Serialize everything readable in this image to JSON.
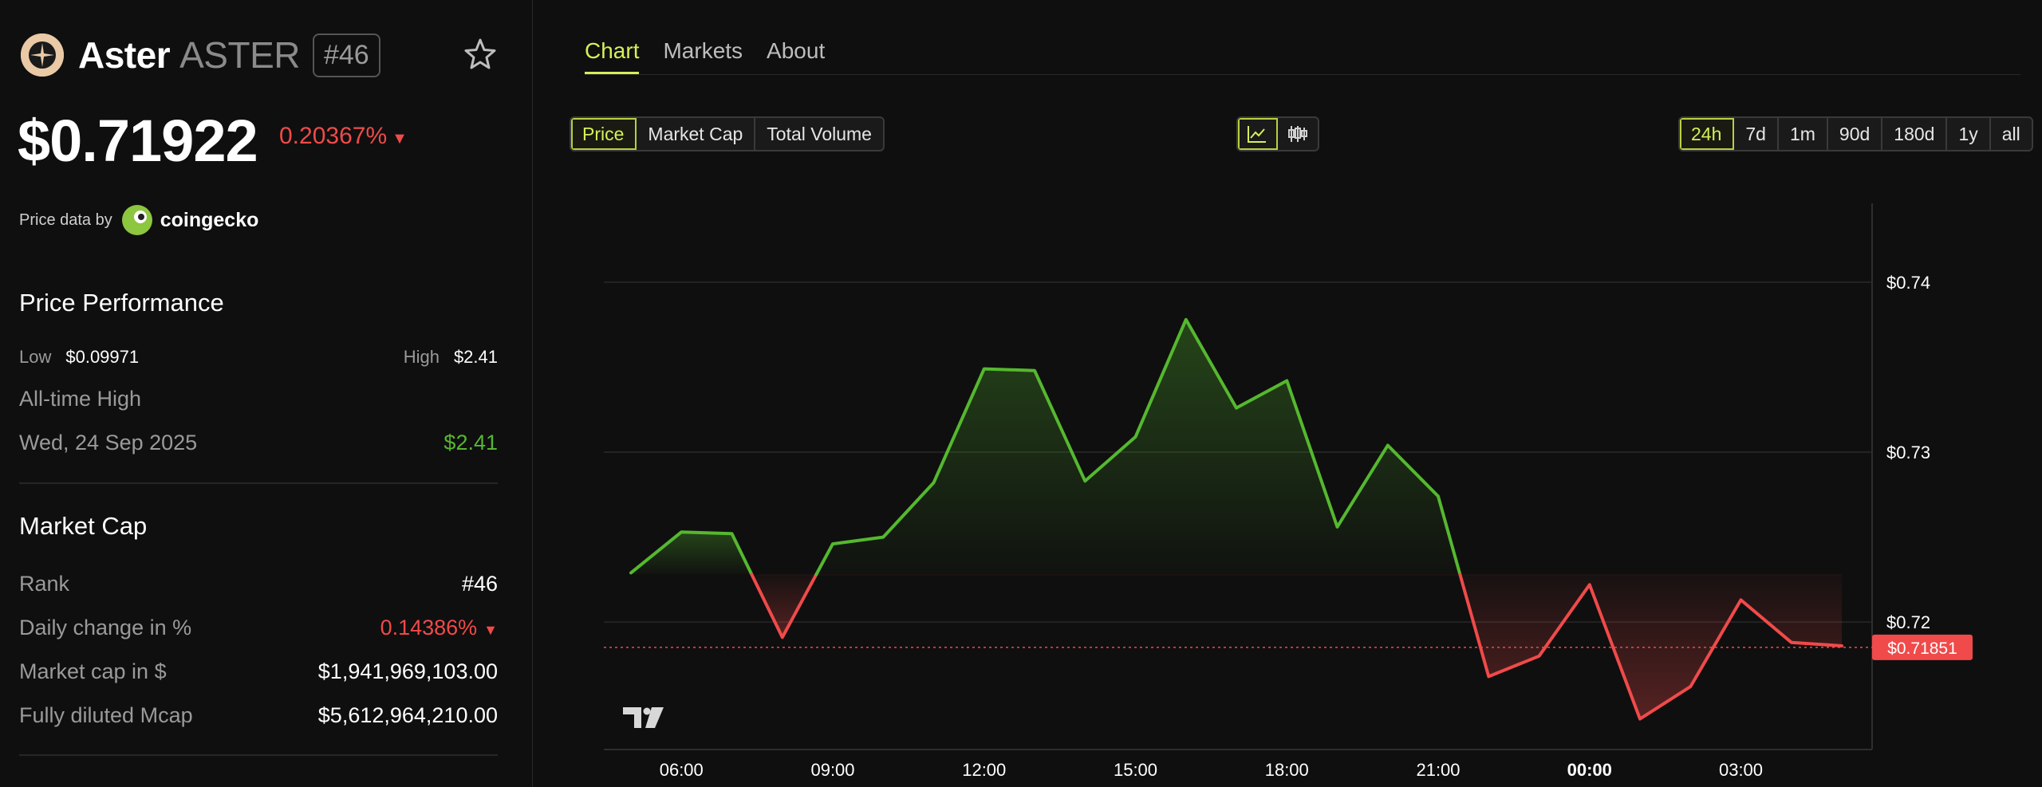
{
  "coin": {
    "name": "Aster",
    "ticker": "ASTER",
    "rank_badge": "#46",
    "price": "$0.71922",
    "change": "0.20367%",
    "change_direction": "down"
  },
  "price_data": {
    "label": "Price data by",
    "provider": "coingecko"
  },
  "performance": {
    "title": "Price Performance",
    "low_label": "Low",
    "low_value": "$0.09971",
    "high_label": "High",
    "high_value": "$2.41",
    "ath_label": "All-time High",
    "ath_date": "Wed, 24 Sep 2025",
    "ath_value": "$2.41"
  },
  "market_cap": {
    "title": "Market Cap",
    "rows": [
      {
        "label": "Rank",
        "value": "#46"
      },
      {
        "label": "Daily change in %",
        "value": "0.14386%"
      },
      {
        "label": "Market cap in $",
        "value": "$1,941,969,103.00"
      },
      {
        "label": "Fully diluted Mcap",
        "value": "$5,612,964,210.00"
      }
    ]
  },
  "tabs": [
    "Chart",
    "Markets",
    "About"
  ],
  "metric_options": [
    "Price",
    "Market Cap",
    "Total Volume"
  ],
  "range_options": [
    "24h",
    "7d",
    "1m",
    "90d",
    "180d",
    "1y",
    "all"
  ],
  "icons": {
    "line_chart": "line-chart-icon",
    "candles": "candlestick-icon",
    "favorite": "star-icon"
  },
  "colors": {
    "accent": "#d4f05a",
    "up": "#55b82f",
    "down": "#f04a4a",
    "background": "#0f0f0f"
  },
  "chart_data": {
    "type": "line",
    "ylim": [
      0.7125,
      0.7445
    ],
    "yticks": [
      {
        "value": 0.74,
        "label": "$0.74"
      },
      {
        "value": 0.73,
        "label": "$0.73"
      },
      {
        "value": 0.72,
        "label": "$0.72"
      }
    ],
    "xticks": [
      {
        "x": 1,
        "label": "06:00",
        "bold": false
      },
      {
        "x": 4,
        "label": "09:00",
        "bold": false
      },
      {
        "x": 7,
        "label": "12:00",
        "bold": false
      },
      {
        "x": 10,
        "label": "15:00",
        "bold": false
      },
      {
        "x": 13,
        "label": "18:00",
        "bold": false
      },
      {
        "x": 16,
        "label": "21:00",
        "bold": false
      },
      {
        "x": 19,
        "label": "00:00",
        "bold": true
      },
      {
        "x": 22,
        "label": "03:00",
        "bold": false
      }
    ],
    "baseline": 0.7228,
    "current": {
      "value": 0.71851,
      "label": "$0.71851"
    },
    "series": [
      {
        "x": [
          0,
          1,
          2,
          3,
          4,
          5,
          6,
          7,
          8,
          9,
          10,
          11,
          12,
          13,
          14,
          15,
          16,
          17,
          18,
          19,
          20,
          21,
          22,
          23,
          24
        ],
        "values": [
          0.7229,
          0.7253,
          0.7252,
          0.7191,
          0.7246,
          0.725,
          0.7282,
          0.7349,
          0.7348,
          0.7283,
          0.7309,
          0.7378,
          0.7326,
          0.7342,
          0.7256,
          0.7304,
          0.7274,
          0.7168,
          0.718,
          0.7222,
          0.7143,
          0.7162,
          0.7213,
          0.7188,
          0.7186
        ]
      }
    ]
  }
}
